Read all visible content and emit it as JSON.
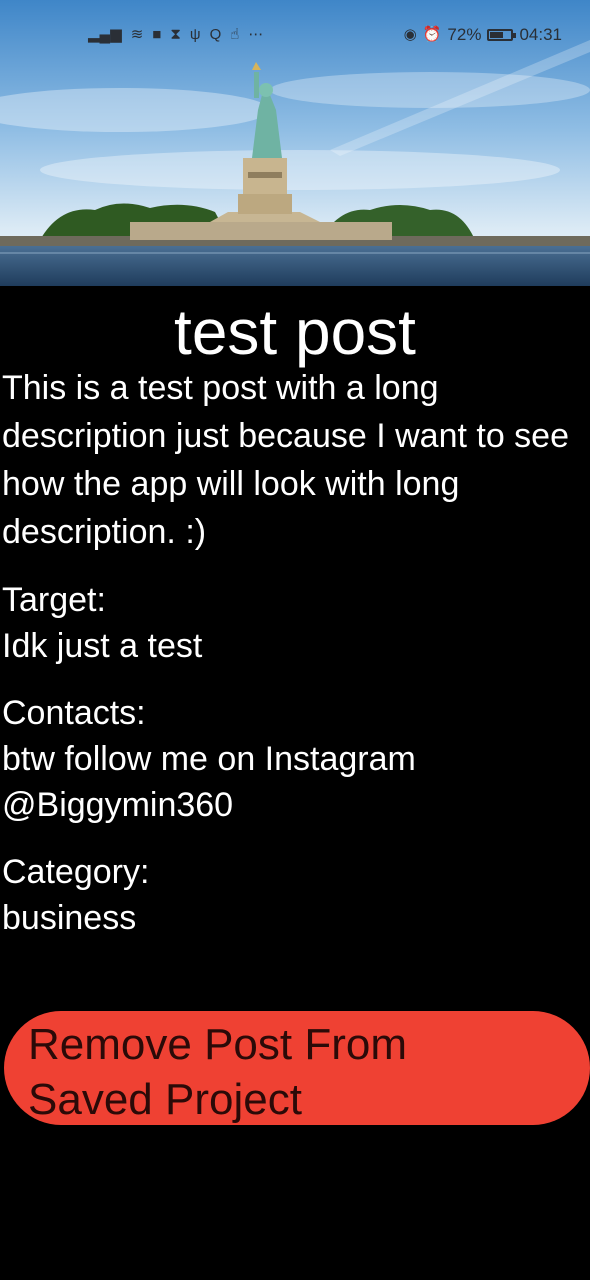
{
  "status_bar": {
    "left_icons": [
      "signal-icon",
      "wifi-icon",
      "video-icon",
      "hourglass-icon",
      "usb-icon",
      "search-icon",
      "touch-icon",
      "more-icon"
    ],
    "battery_percent": "72%",
    "battery_level": 0.72,
    "time": "04:31"
  },
  "hero_image": {
    "subject": "statue-of-liberty"
  },
  "post": {
    "title": "test post",
    "description": "This is a test post with a long description just because I want to see how the app will look with long description. :)",
    "target_label": "Target:",
    "target_value": "Idk just a test",
    "contacts_label": "Contacts:",
    "contacts_value": "btw follow me on Instagram @Biggymin360",
    "category_label": "Category:",
    "category_value": "business"
  },
  "actions": {
    "remove_label": "Remove Post From Saved Project"
  },
  "colors": {
    "background": "#000000",
    "text": "#ffffff",
    "button": "#ef4133",
    "button_text": "#2b0a08"
  }
}
